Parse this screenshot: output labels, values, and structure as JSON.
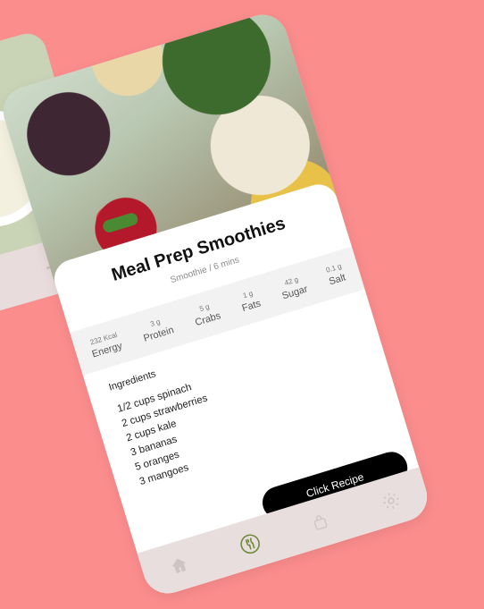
{
  "recipe": {
    "title": "Meal Prep Smoothies",
    "subtitle": "Smoothie / 6 mins"
  },
  "nutrition": [
    {
      "value": "232 Kcal",
      "label": "Energy"
    },
    {
      "value": "3 g",
      "label": "Protein"
    },
    {
      "value": "5 g",
      "label": "Crabs"
    },
    {
      "value": "1 g",
      "label": "Fats"
    },
    {
      "value": "42 g",
      "label": "Sugar"
    },
    {
      "value": "0.1 g",
      "label": "Salt"
    }
  ],
  "ingredients": {
    "heading": "Ingredients",
    "items": [
      "1/2 cups spinach",
      "2 cups strawberries",
      "2 cups kale",
      "3 bananas",
      "5 oranges",
      "3 mangoes"
    ]
  },
  "cta": {
    "label": "Click Recipe"
  },
  "nav": {
    "icons": [
      "home-icon",
      "fork-knife-icon",
      "bag-icon",
      "gear-icon"
    ],
    "active": "fork-knife-icon"
  },
  "colors": {
    "background": "#fb8d8d",
    "accent": "#6f8a3a",
    "cta": "#000000"
  }
}
